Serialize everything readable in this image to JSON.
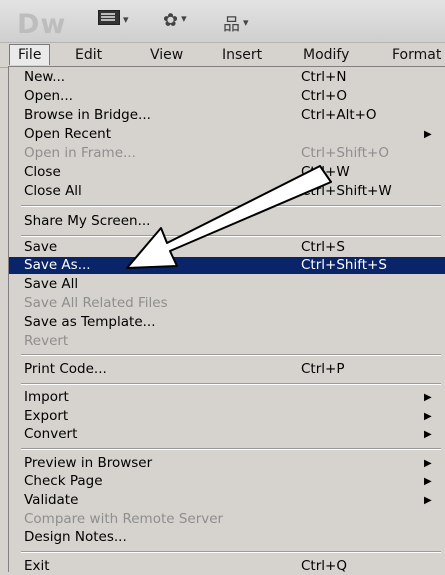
{
  "toolbar": {
    "logo": "Dw",
    "caret": "▾",
    "gear_glyph": "✿",
    "site_glyph": "品"
  },
  "menubar": {
    "items": [
      "File",
      "Edit",
      "View",
      "Insert",
      "Modify",
      "Format"
    ]
  },
  "file_menu": {
    "new": {
      "label": "New...",
      "shortcut": "Ctrl+N"
    },
    "open": {
      "label": "Open...",
      "shortcut": "Ctrl+O"
    },
    "browse_bridge": {
      "label": "Browse in Bridge...",
      "shortcut": "Ctrl+Alt+O"
    },
    "open_recent": {
      "label": "Open Recent"
    },
    "open_in_frame": {
      "label": "Open in Frame...",
      "shortcut": "Ctrl+Shift+O"
    },
    "close": {
      "label": "Close",
      "shortcut": "Ctrl+W"
    },
    "close_all": {
      "label": "Close All",
      "shortcut": "Ctrl+Shift+W"
    },
    "share_screen": {
      "label": "Share My Screen..."
    },
    "save": {
      "label": "Save",
      "shortcut": "Ctrl+S"
    },
    "save_as": {
      "label": "Save As...",
      "shortcut": "Ctrl+Shift+S"
    },
    "save_all": {
      "label": "Save All"
    },
    "save_related": {
      "label": "Save All Related Files"
    },
    "save_template": {
      "label": "Save as Template..."
    },
    "revert": {
      "label": "Revert"
    },
    "print_code": {
      "label": "Print Code...",
      "shortcut": "Ctrl+P"
    },
    "import": {
      "label": "Import"
    },
    "export": {
      "label": "Export"
    },
    "convert": {
      "label": "Convert"
    },
    "preview_browser": {
      "label": "Preview in Browser"
    },
    "check_page": {
      "label": "Check Page"
    },
    "validate": {
      "label": "Validate"
    },
    "compare_remote": {
      "label": "Compare with Remote Server"
    },
    "design_notes": {
      "label": "Design Notes..."
    },
    "exit": {
      "label": "Exit",
      "shortcut": "Ctrl+Q"
    },
    "submenu_arrow": "▶"
  },
  "colors": {
    "highlight": "#0a246a",
    "disabled_text": "#8e8e8e",
    "menu_bg": "#d6d3ce"
  }
}
